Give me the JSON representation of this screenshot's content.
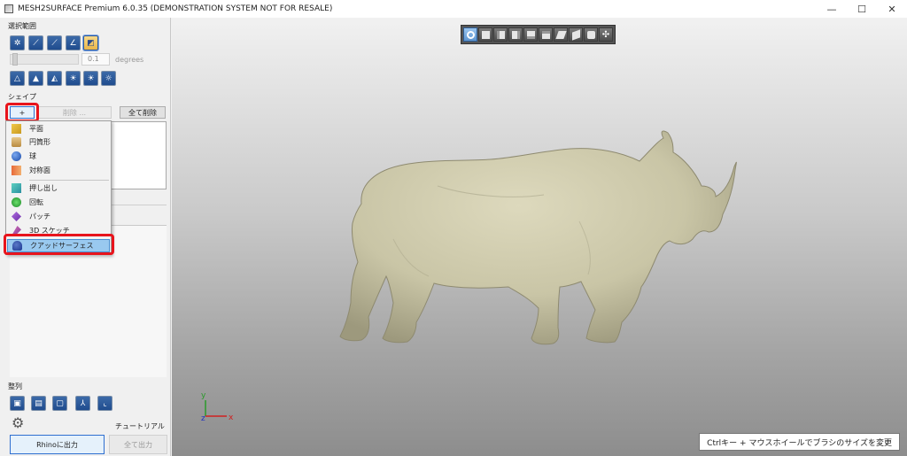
{
  "window": {
    "title": "MESH2SURFACE Premium 6.0.35 (DEMONSTRATION SYSTEM NOT FOR RESALE)",
    "minimize": "—",
    "maximize": "☐",
    "close": "✕"
  },
  "selection": {
    "label": "選択範囲",
    "angle_value": "0.1",
    "angle_unit": "degrees"
  },
  "shapes": {
    "label": "シェイプ",
    "add_label": "+",
    "delete_label": "削除 ...",
    "delete_all_label": "全て削除"
  },
  "add_menu": {
    "items": [
      {
        "label": "平面",
        "icon": "plane-icon"
      },
      {
        "label": "円筒形",
        "icon": "cylinder-icon"
      },
      {
        "label": "球",
        "icon": "sphere-icon"
      },
      {
        "label": "対称面",
        "icon": "symmetry-plane-icon"
      },
      {
        "label": "押し出し",
        "icon": "extrude-icon"
      },
      {
        "label": "回転",
        "icon": "revolve-icon"
      },
      {
        "label": "パッチ",
        "icon": "patch-icon"
      },
      {
        "label": "3D スケッチ",
        "icon": "sketch-3d-icon"
      },
      {
        "label": "クアッドサーフェス",
        "icon": "quad-surface-icon"
      }
    ],
    "selected": "クアッドサーフェス"
  },
  "align": {
    "label": "整列"
  },
  "footer": {
    "tutorial_label": "チュートリアル",
    "rhino_export_label": "Rhinoに出力",
    "export_all_label": "全て出力"
  },
  "viewport": {
    "axis_x": "x",
    "axis_y": "y",
    "axis_z": "z",
    "status_hint": "Ctrlキー + マウスホイールでブラシのサイズを変更"
  },
  "colors": {
    "highlight": "#e8141c",
    "model": "#c9c5a6",
    "menu_selected": "#99c9ef"
  }
}
